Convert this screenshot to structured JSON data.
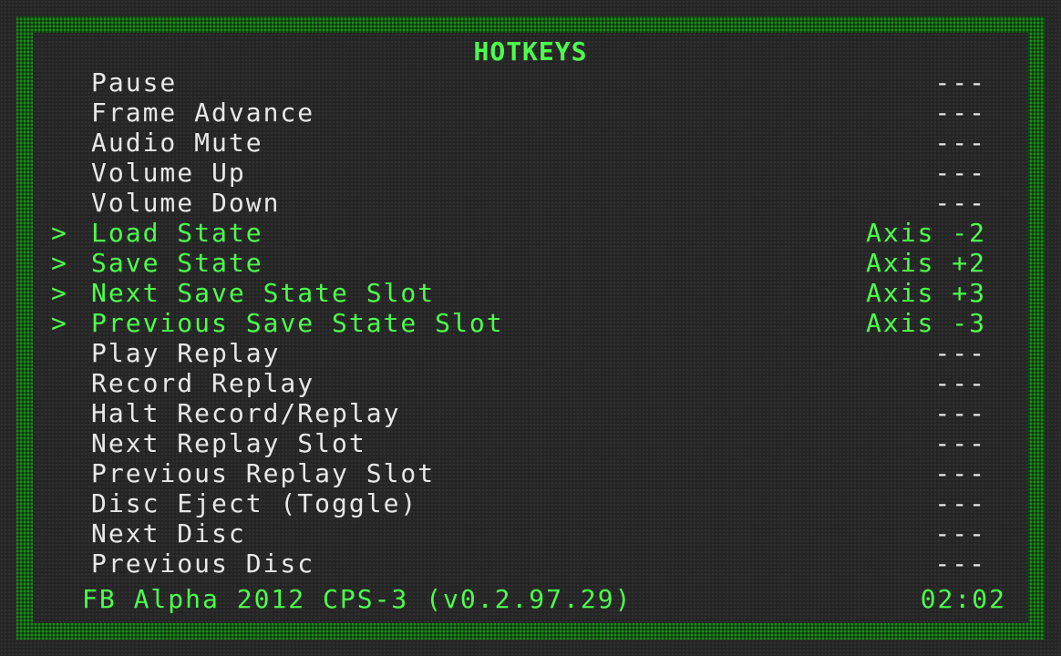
{
  "menu": {
    "title": "HOTKEYS",
    "cursor_glyph": ">",
    "accent_color": "#4cff4c",
    "text_color": "#e8e8e8",
    "border_color": "#1f8a1f",
    "items": [
      {
        "label": "Pause",
        "value": "---",
        "selected": false
      },
      {
        "label": "Frame Advance",
        "value": "---",
        "selected": false
      },
      {
        "label": "Audio Mute",
        "value": "---",
        "selected": false
      },
      {
        "label": "Volume Up",
        "value": "---",
        "selected": false
      },
      {
        "label": "Volume Down",
        "value": "---",
        "selected": false
      },
      {
        "label": "Load State",
        "value": "Axis -2",
        "selected": true
      },
      {
        "label": "Save State",
        "value": "Axis +2",
        "selected": true
      },
      {
        "label": "Next Save State Slot",
        "value": "Axis +3",
        "selected": true
      },
      {
        "label": "Previous Save State Slot",
        "value": "Axis -3",
        "selected": true
      },
      {
        "label": "Play Replay",
        "value": "---",
        "selected": false
      },
      {
        "label": "Record Replay",
        "value": "---",
        "selected": false
      },
      {
        "label": "Halt Record/Replay",
        "value": "---",
        "selected": false
      },
      {
        "label": "Next Replay Slot",
        "value": "---",
        "selected": false
      },
      {
        "label": "Previous Replay Slot",
        "value": "---",
        "selected": false
      },
      {
        "label": "Disc Eject (Toggle)",
        "value": "---",
        "selected": false
      },
      {
        "label": "Next Disc",
        "value": "---",
        "selected": false
      },
      {
        "label": "Previous Disc",
        "value": "---",
        "selected": false
      }
    ]
  },
  "footer": {
    "core_name": "FB Alpha 2012 CPS-3 (v0.2.97.29)",
    "clock": "02:02"
  }
}
